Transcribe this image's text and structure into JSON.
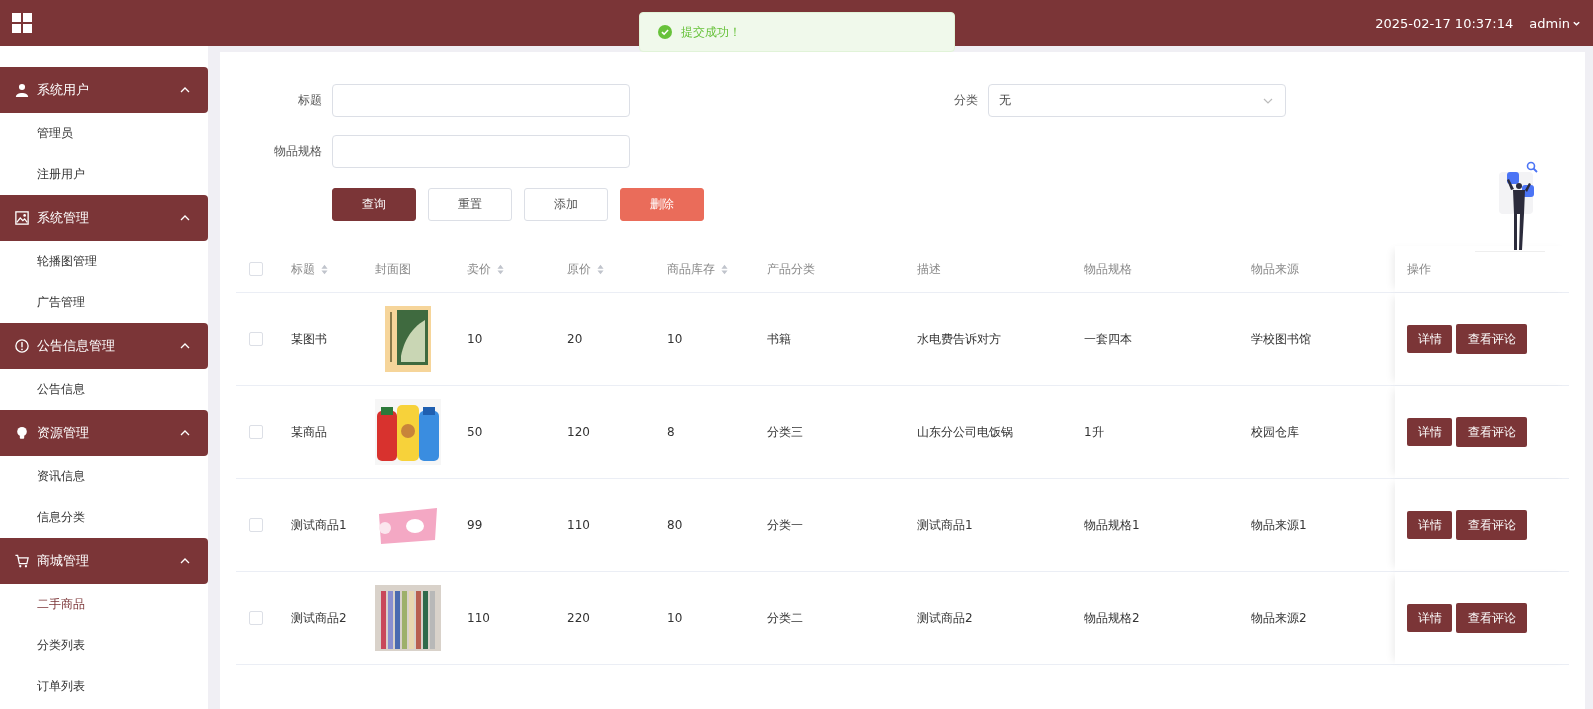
{
  "header": {
    "datetime": "2025-02-17 10:37:14",
    "user": "admin"
  },
  "toast": {
    "kind": "success",
    "message": "提交成功！"
  },
  "sidebar": {
    "groups": [
      {
        "title": "系统用户",
        "expanded": true,
        "items": [
          {
            "label": "管理员",
            "selected": false
          },
          {
            "label": "注册用户",
            "selected": false
          }
        ]
      },
      {
        "title": "系统管理",
        "expanded": true,
        "items": [
          {
            "label": "轮播图管理",
            "selected": false
          },
          {
            "label": "广告管理",
            "selected": false
          }
        ]
      },
      {
        "title": "公告信息管理",
        "expanded": true,
        "items": [
          {
            "label": "公告信息",
            "selected": false
          }
        ]
      },
      {
        "title": "资源管理",
        "expanded": true,
        "items": [
          {
            "label": "资讯信息",
            "selected": false
          },
          {
            "label": "信息分类",
            "selected": false
          }
        ]
      },
      {
        "title": "商城管理",
        "expanded": true,
        "items": [
          {
            "label": "二手商品",
            "selected": true
          },
          {
            "label": "分类列表",
            "selected": false
          },
          {
            "label": "订单列表",
            "selected": false
          }
        ]
      }
    ]
  },
  "filters": [
    {
      "label": "标题",
      "kind": "text"
    },
    {
      "label": "分类",
      "kind": "select",
      "value": "无"
    },
    {
      "label": "物品规格",
      "kind": "text"
    }
  ],
  "buttons": [
    {
      "label": "查询",
      "kind": "primary"
    },
    {
      "label": "重置",
      "kind": "plain"
    },
    {
      "label": "添加",
      "kind": "plain"
    },
    {
      "label": "删除",
      "kind": "danger"
    }
  ],
  "table": {
    "columns": [
      {
        "label": "标题",
        "sortable": true
      },
      {
        "label": "封面图",
        "sortable": false
      },
      {
        "label": "卖价",
        "sortable": true
      },
      {
        "label": "原价",
        "sortable": true
      },
      {
        "label": "商品库存",
        "sortable": true
      },
      {
        "label": "产品分类",
        "sortable": false
      },
      {
        "label": "描述",
        "sortable": false
      },
      {
        "label": "物品规格",
        "sortable": false
      },
      {
        "label": "物品来源",
        "sortable": false
      },
      {
        "label": "操作",
        "sortable": false
      }
    ],
    "select_all": {
      "checked": false
    },
    "rows": [
      {
        "checked": false,
        "cells": [
          "某图书",
          {
            "kind": "picture"
          },
          "10",
          "20",
          "10",
          "书籍",
          "水电费告诉对方",
          "一套四本",
          "学校图书馆",
          {
            "kind": "actions",
            "buttons": [
              "详情",
              "查看评论"
            ]
          }
        ]
      },
      {
        "checked": false,
        "cells": [
          "某商品",
          {
            "kind": "picture"
          },
          "50",
          "120",
          "8",
          "分类三",
          "山东分公司电饭锅",
          "1升",
          "校园仓库",
          {
            "kind": "actions",
            "buttons": [
              "详情",
              "查看评论"
            ]
          }
        ]
      },
      {
        "checked": false,
        "cells": [
          "测试商品1",
          {
            "kind": "picture"
          },
          "99",
          "110",
          "80",
          "分类一",
          "测试商品1",
          "物品规格1",
          "物品来源1",
          {
            "kind": "actions",
            "buttons": [
              "详情",
              "查看评论"
            ]
          }
        ]
      },
      {
        "checked": false,
        "cells": [
          "测试商品2",
          {
            "kind": "picture"
          },
          "110",
          "220",
          "10",
          "分类二",
          "测试商品2",
          "物品规格2",
          "物品来源2",
          {
            "kind": "actions",
            "buttons": [
              "详情",
              "查看评论"
            ]
          }
        ]
      }
    ]
  }
}
